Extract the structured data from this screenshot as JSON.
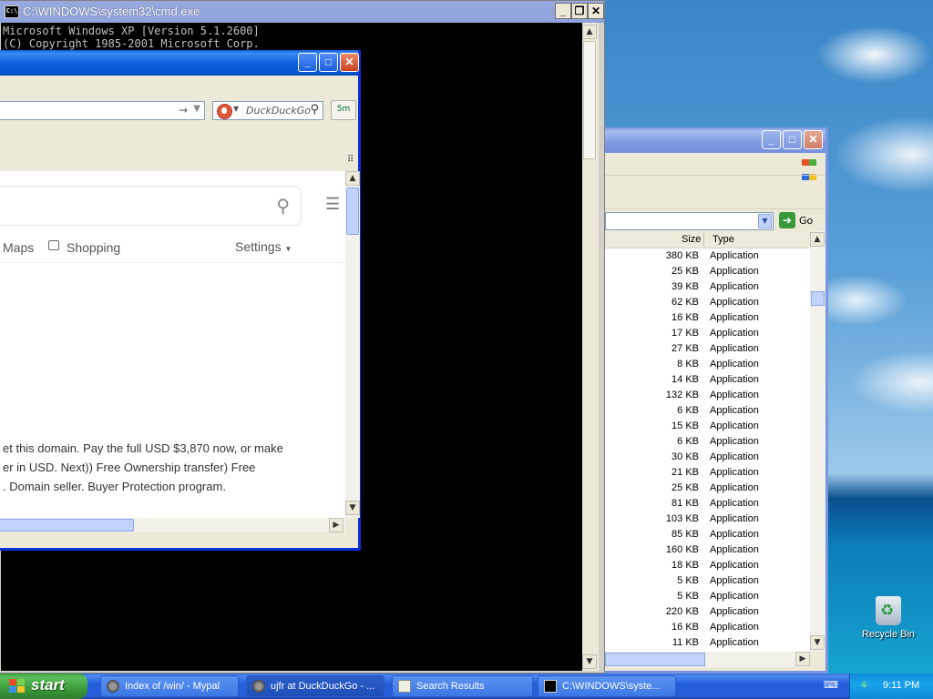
{
  "cmd": {
    "title": "C:\\WINDOWS\\system32\\cmd.exe",
    "lines": [
      "Microsoft Windows XP [Version 5.1.2600]",
      "(C) Copyright 1985-2001 Microsoft Corp."
    ]
  },
  "browser": {
    "search_placeholder": "DuckDuckGo",
    "addon_label": "5m",
    "nav": {
      "maps": "Maps",
      "shopping": "Shopping",
      "settings": "Settings"
    },
    "text_lines": [
      "et this domain. Pay the full USD $3,870 now, or make",
      "er in USD. Next)) Free Ownership transfer) Free",
      ". Domain seller. Buyer Protection program."
    ]
  },
  "explorer": {
    "go_label": "Go",
    "columns": {
      "size": "Size",
      "type": "Type"
    },
    "rows": [
      {
        "size": "380 KB",
        "type": "Application"
      },
      {
        "size": "25 KB",
        "type": "Application"
      },
      {
        "size": "39 KB",
        "type": "Application"
      },
      {
        "size": "62 KB",
        "type": "Application"
      },
      {
        "size": "16 KB",
        "type": "Application"
      },
      {
        "size": "17 KB",
        "type": "Application"
      },
      {
        "size": "27 KB",
        "type": "Application"
      },
      {
        "size": "8 KB",
        "type": "Application"
      },
      {
        "size": "14 KB",
        "type": "Application"
      },
      {
        "size": "132 KB",
        "type": "Application"
      },
      {
        "size": "6 KB",
        "type": "Application"
      },
      {
        "size": "15 KB",
        "type": "Application"
      },
      {
        "size": "6 KB",
        "type": "Application"
      },
      {
        "size": "30 KB",
        "type": "Application"
      },
      {
        "size": "21 KB",
        "type": "Application"
      },
      {
        "size": "25 KB",
        "type": "Application"
      },
      {
        "size": "81 KB",
        "type": "Application"
      },
      {
        "size": "103 KB",
        "type": "Application"
      },
      {
        "size": "85 KB",
        "type": "Application"
      },
      {
        "size": "160 KB",
        "type": "Application"
      },
      {
        "size": "18 KB",
        "type": "Application"
      },
      {
        "size": "5 KB",
        "type": "Application"
      },
      {
        "size": "5 KB",
        "type": "Application"
      },
      {
        "size": "220 KB",
        "type": "Application"
      },
      {
        "size": "16 KB",
        "type": "Application"
      },
      {
        "size": "11 KB",
        "type": "Application"
      }
    ]
  },
  "desktop": {
    "recycle_bin": "Recycle Bin"
  },
  "taskbar": {
    "start": "start",
    "tasks": [
      "Index of /win/ - Mypal",
      "ujfr at DuckDuckGo - ...",
      "Search Results",
      "C:\\WINDOWS\\syste..."
    ],
    "clock": "9:11 PM"
  },
  "colors": {
    "taskbar_blue": "#245edb",
    "start_green": "#3a9a3a",
    "title_active": "#0553d0",
    "title_inactive": "#7f9ae2",
    "cmd_bg": "#000000",
    "cmd_fg": "#c0c0c0"
  },
  "icons": [
    "cmd-icon",
    "minimize-icon",
    "maximize-icon",
    "close-icon",
    "forward-arrow-icon",
    "duckduckgo-icon",
    "magnifier-icon",
    "hamburger-menu-icon",
    "shopping-bag-icon",
    "caret-down-icon",
    "windows-flag-icon",
    "go-arrow-icon",
    "recycle-bin-icon",
    "keyboard-icon",
    "network-icon"
  ]
}
